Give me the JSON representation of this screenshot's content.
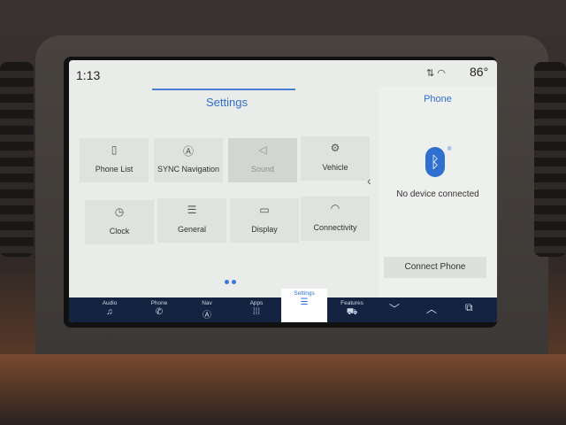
{
  "status": {
    "time": "1:13",
    "temperature": "86°"
  },
  "main": {
    "title": "Settings"
  },
  "tiles": [
    {
      "label": "Phone List",
      "icon": "phone-list-icon",
      "glyph": "▯"
    },
    {
      "label": "SYNC Navigation",
      "icon": "navigation-icon",
      "glyph": "Ⓐ"
    },
    {
      "label": "Sound",
      "icon": "speaker-icon",
      "glyph": "◁"
    },
    {
      "label": "Vehicle",
      "icon": "vehicle-icon",
      "glyph": "⚙"
    },
    {
      "label": "Clock",
      "icon": "clock-icon",
      "glyph": "◷"
    },
    {
      "label": "General",
      "icon": "sliders-icon",
      "glyph": "☰"
    },
    {
      "label": "Display",
      "icon": "display-icon",
      "glyph": "▭"
    },
    {
      "label": "Connectivity",
      "icon": "wifi-icon",
      "glyph": "◠"
    }
  ],
  "phone_panel": {
    "title": "Phone",
    "status": "No device connected",
    "connect_label": "Connect Phone"
  },
  "navbar": {
    "items": [
      {
        "label": "Audio",
        "glyph": "♫"
      },
      {
        "label": "Phone",
        "glyph": "✆"
      },
      {
        "label": "Nav",
        "glyph": "Ⓐ"
      },
      {
        "label": "Apps",
        "glyph": "⁞⁞⁞"
      },
      {
        "label": "Settings",
        "glyph": "☰"
      },
      {
        "label": "Features",
        "glyph": "⛟"
      }
    ],
    "active": "Settings"
  },
  "colors": {
    "accent": "#2f6fd0",
    "navbar": "#14233f",
    "display_bg": "#e9ece8"
  }
}
